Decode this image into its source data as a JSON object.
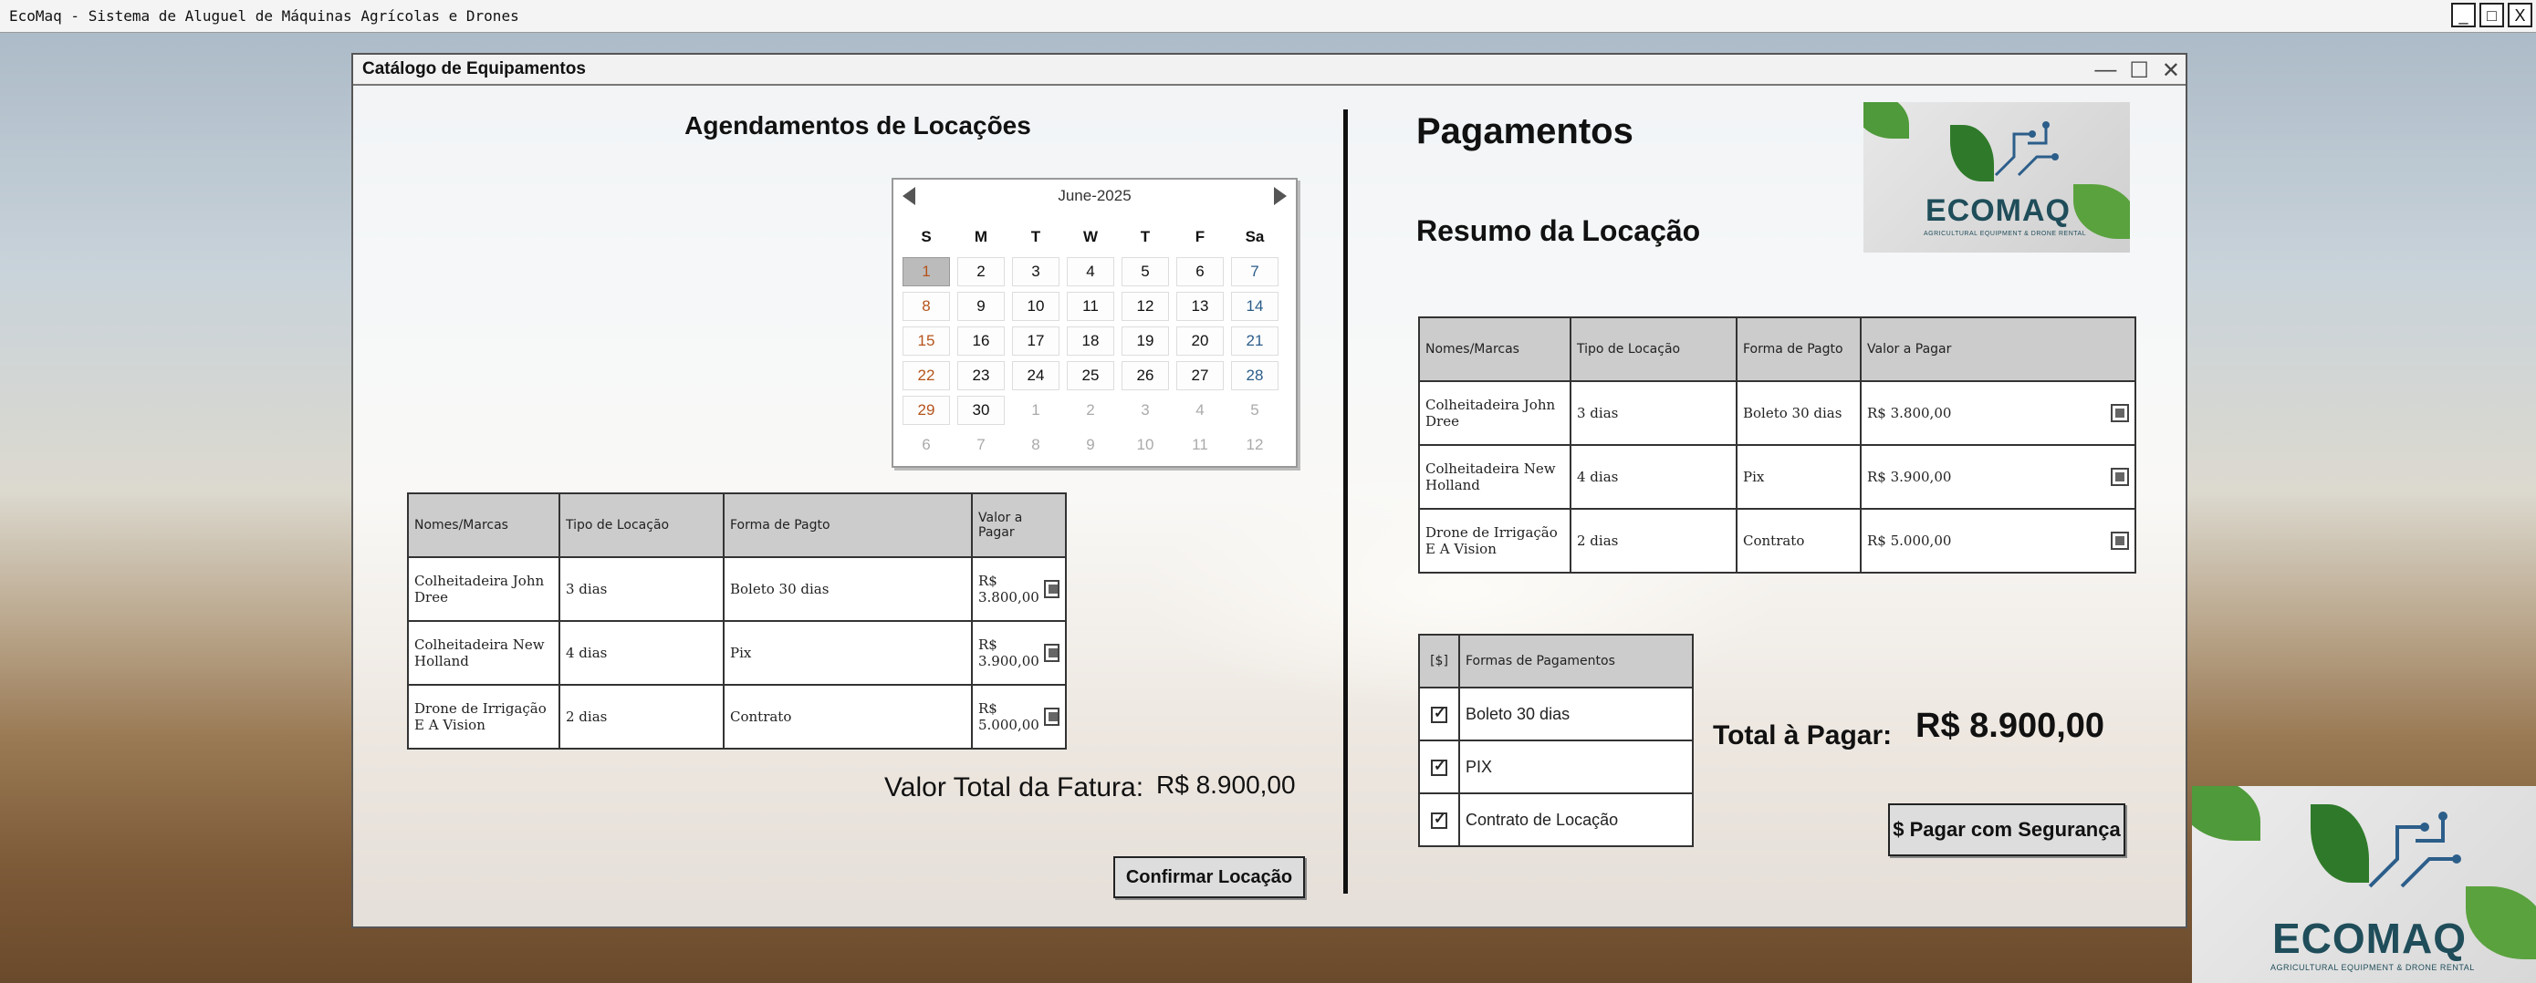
{
  "app": {
    "title": "EcoMaq - Sistema de Aluguel de Máquinas Agrícolas e Drones",
    "controls": [
      "_",
      "□",
      "X"
    ]
  },
  "window": {
    "title": "Catálogo de Equipamentos",
    "controls": [
      "—",
      "☐",
      "✕"
    ]
  },
  "left": {
    "heading": "Agendamentos de Locações",
    "calendar": {
      "month_label": "June-2025",
      "day_names": [
        "S",
        "M",
        "T",
        "W",
        "T",
        "F",
        "Sa"
      ],
      "weeks": [
        [
          "1",
          "2",
          "3",
          "4",
          "5",
          "6",
          "7"
        ],
        [
          "8",
          "9",
          "10",
          "11",
          "12",
          "13",
          "14"
        ],
        [
          "15",
          "16",
          "17",
          "18",
          "19",
          "20",
          "21"
        ],
        [
          "22",
          "23",
          "24",
          "25",
          "26",
          "27",
          "28"
        ],
        [
          "29",
          "30",
          "1",
          "2",
          "3",
          "4",
          "5"
        ],
        [
          "6",
          "7",
          "8",
          "9",
          "10",
          "11",
          "12"
        ]
      ],
      "selected": "1"
    },
    "table": {
      "headers": [
        "Nomes/Marcas",
        "Tipo de Locação",
        "Forma de Pagto",
        "Valor a Pagar"
      ],
      "rows": [
        [
          "Colheitadeira John Dree",
          "3 dias",
          "Boleto 30 dias",
          "R$ 3.800,00"
        ],
        [
          "Colheitadeira New Holland",
          "4 dias",
          "Pix",
          "R$ 3.900,00"
        ],
        [
          "Drone de Irrigação E A Vision",
          "2 dias",
          "Contrato",
          "R$ 5.000,00"
        ]
      ]
    },
    "total_label": "Valor Total da Fatura:",
    "total_value": "R$ 8.900,00",
    "confirm_button": "Confirmar Locação"
  },
  "right": {
    "heading": "Pagamentos",
    "subheading": "Resumo da Locação",
    "logo": {
      "word": "ECOMAQ",
      "tagline": "AGRICULTURAL EQUIPMENT & DRONE RENTAL"
    },
    "table": {
      "headers": [
        "Nomes/Marcas",
        "Tipo de Locação",
        "Forma de Pagto",
        "Valor a Pagar"
      ],
      "rows": [
        [
          "Colheitadeira John Dree",
          "3 dias",
          "Boleto 30 dias",
          "R$ 3.800,00"
        ],
        [
          "Colheitadeira New Holland",
          "4 dias",
          "Pix",
          "R$ 3.900,00"
        ],
        [
          "Drone de Irrigação E A Vision",
          "2 dias",
          "Contrato",
          "R$ 5.000,00"
        ]
      ]
    },
    "payment_methods": {
      "icon_header": "[$]",
      "header": "Formas de Pagamentos",
      "items": [
        "Boleto 30 dias",
        "PIX",
        "Contrato de Locação"
      ]
    },
    "total_label": "Total à Pagar:",
    "total_value": "R$ 8.900,00",
    "pay_button": "$ Pagar com Segurança"
  },
  "corner_logo": {
    "word": "ECOMAQ",
    "tagline": "AGRICULTURAL EQUIPMENT & DRONE RENTAL"
  }
}
